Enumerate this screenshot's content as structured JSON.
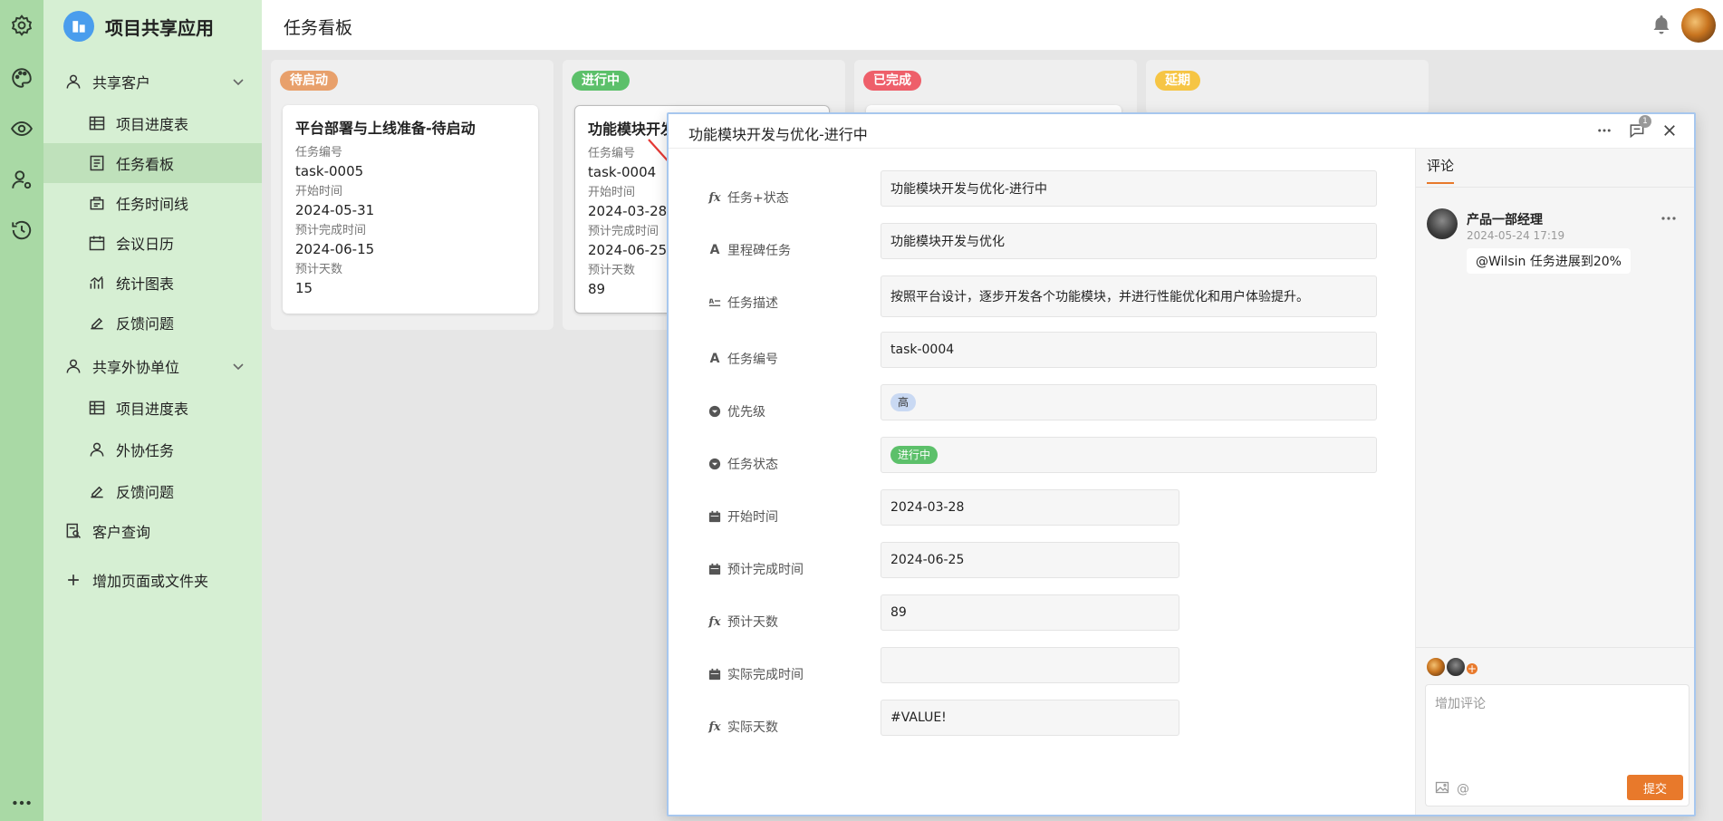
{
  "app": {
    "title": "项目共享应用"
  },
  "topbar": {
    "title": "任务看板"
  },
  "sidebar": {
    "groups": [
      {
        "label": "共享客户",
        "items": [
          "项目进度表",
          "任务看板",
          "任务时间线",
          "会议日历",
          "统计图表",
          "反馈问题"
        ]
      },
      {
        "label": "共享外协单位",
        "items": [
          "项目进度表",
          "外协任务",
          "反馈问题"
        ]
      }
    ],
    "customer_query": "客户查询",
    "add_page": "增加页面或文件夹",
    "active_item": "任务看板"
  },
  "kanban": {
    "columns": [
      {
        "tag": "待启动",
        "color": "#e8a06b"
      },
      {
        "tag": "进行中",
        "color": "#5cc06a"
      },
      {
        "tag": "已完成",
        "color": "#ee5f6a"
      },
      {
        "tag": "延期",
        "color": "#f6c544"
      }
    ],
    "cards": [
      {
        "title": "平台部署与上线准备-待启动",
        "fields": [
          {
            "label": "任务编号",
            "value": "task-0005"
          },
          {
            "label": "开始时间",
            "value": "2024-05-31"
          },
          {
            "label": "预计完成时间",
            "value": "2024-06-15"
          },
          {
            "label": "预计天数",
            "value": "15"
          }
        ]
      },
      {
        "title": "功能模块开发",
        "fields": [
          {
            "label": "任务编号",
            "value": "task-0004"
          },
          {
            "label": "开始时间",
            "value": "2024-03-28"
          },
          {
            "label": "预计完成时间",
            "value": "2024-06-25"
          },
          {
            "label": "预计天数",
            "value": "89"
          }
        ]
      }
    ]
  },
  "modal": {
    "title": "功能模块开发与优化-进行中",
    "comment_badge": "1",
    "fields": [
      {
        "label": "任务+状态",
        "icon": "formula-icon",
        "value": "功能模块开发与优化-进行中"
      },
      {
        "label": "里程碑任务",
        "icon": "text-icon",
        "value": "功能模块开发与优化"
      },
      {
        "label": "任务描述",
        "icon": "long-text-icon",
        "value": "按照平台设计，逐步开发各个功能模块，并进行性能优化和用户体验提升。"
      },
      {
        "label": "任务编号",
        "icon": "text-icon",
        "value": "task-0004"
      },
      {
        "label": "优先级",
        "icon": "select-icon",
        "value": "高",
        "pill_color": "#c9d9f3"
      },
      {
        "label": "任务状态",
        "icon": "select-icon",
        "value": "进行中",
        "pill_color": "#5cc06a"
      },
      {
        "label": "开始时间",
        "icon": "calendar-icon",
        "value": "2024-03-28"
      },
      {
        "label": "预计完成时间",
        "icon": "calendar-icon",
        "value": "2024-06-25"
      },
      {
        "label": "预计天数",
        "icon": "formula-icon",
        "value": "89"
      },
      {
        "label": "实际完成时间",
        "icon": "calendar-icon",
        "value": ""
      },
      {
        "label": "实际天数",
        "icon": "formula-icon",
        "value": "#VALUE!"
      }
    ]
  },
  "comments": {
    "tab_label": "评论",
    "items": [
      {
        "author": "产品一部经理",
        "time": "2024-05-24 17:19",
        "text": "@Wilsin 任务进展到20%"
      }
    ],
    "input_placeholder": "增加评论",
    "at_symbol": "@",
    "submit_label": "提交"
  },
  "colors": {
    "accent": "#e8792b",
    "sidebar_bg": "#d6efd3",
    "rail_bg": "#a9d9a5",
    "active_bg": "#bfe1bb"
  }
}
